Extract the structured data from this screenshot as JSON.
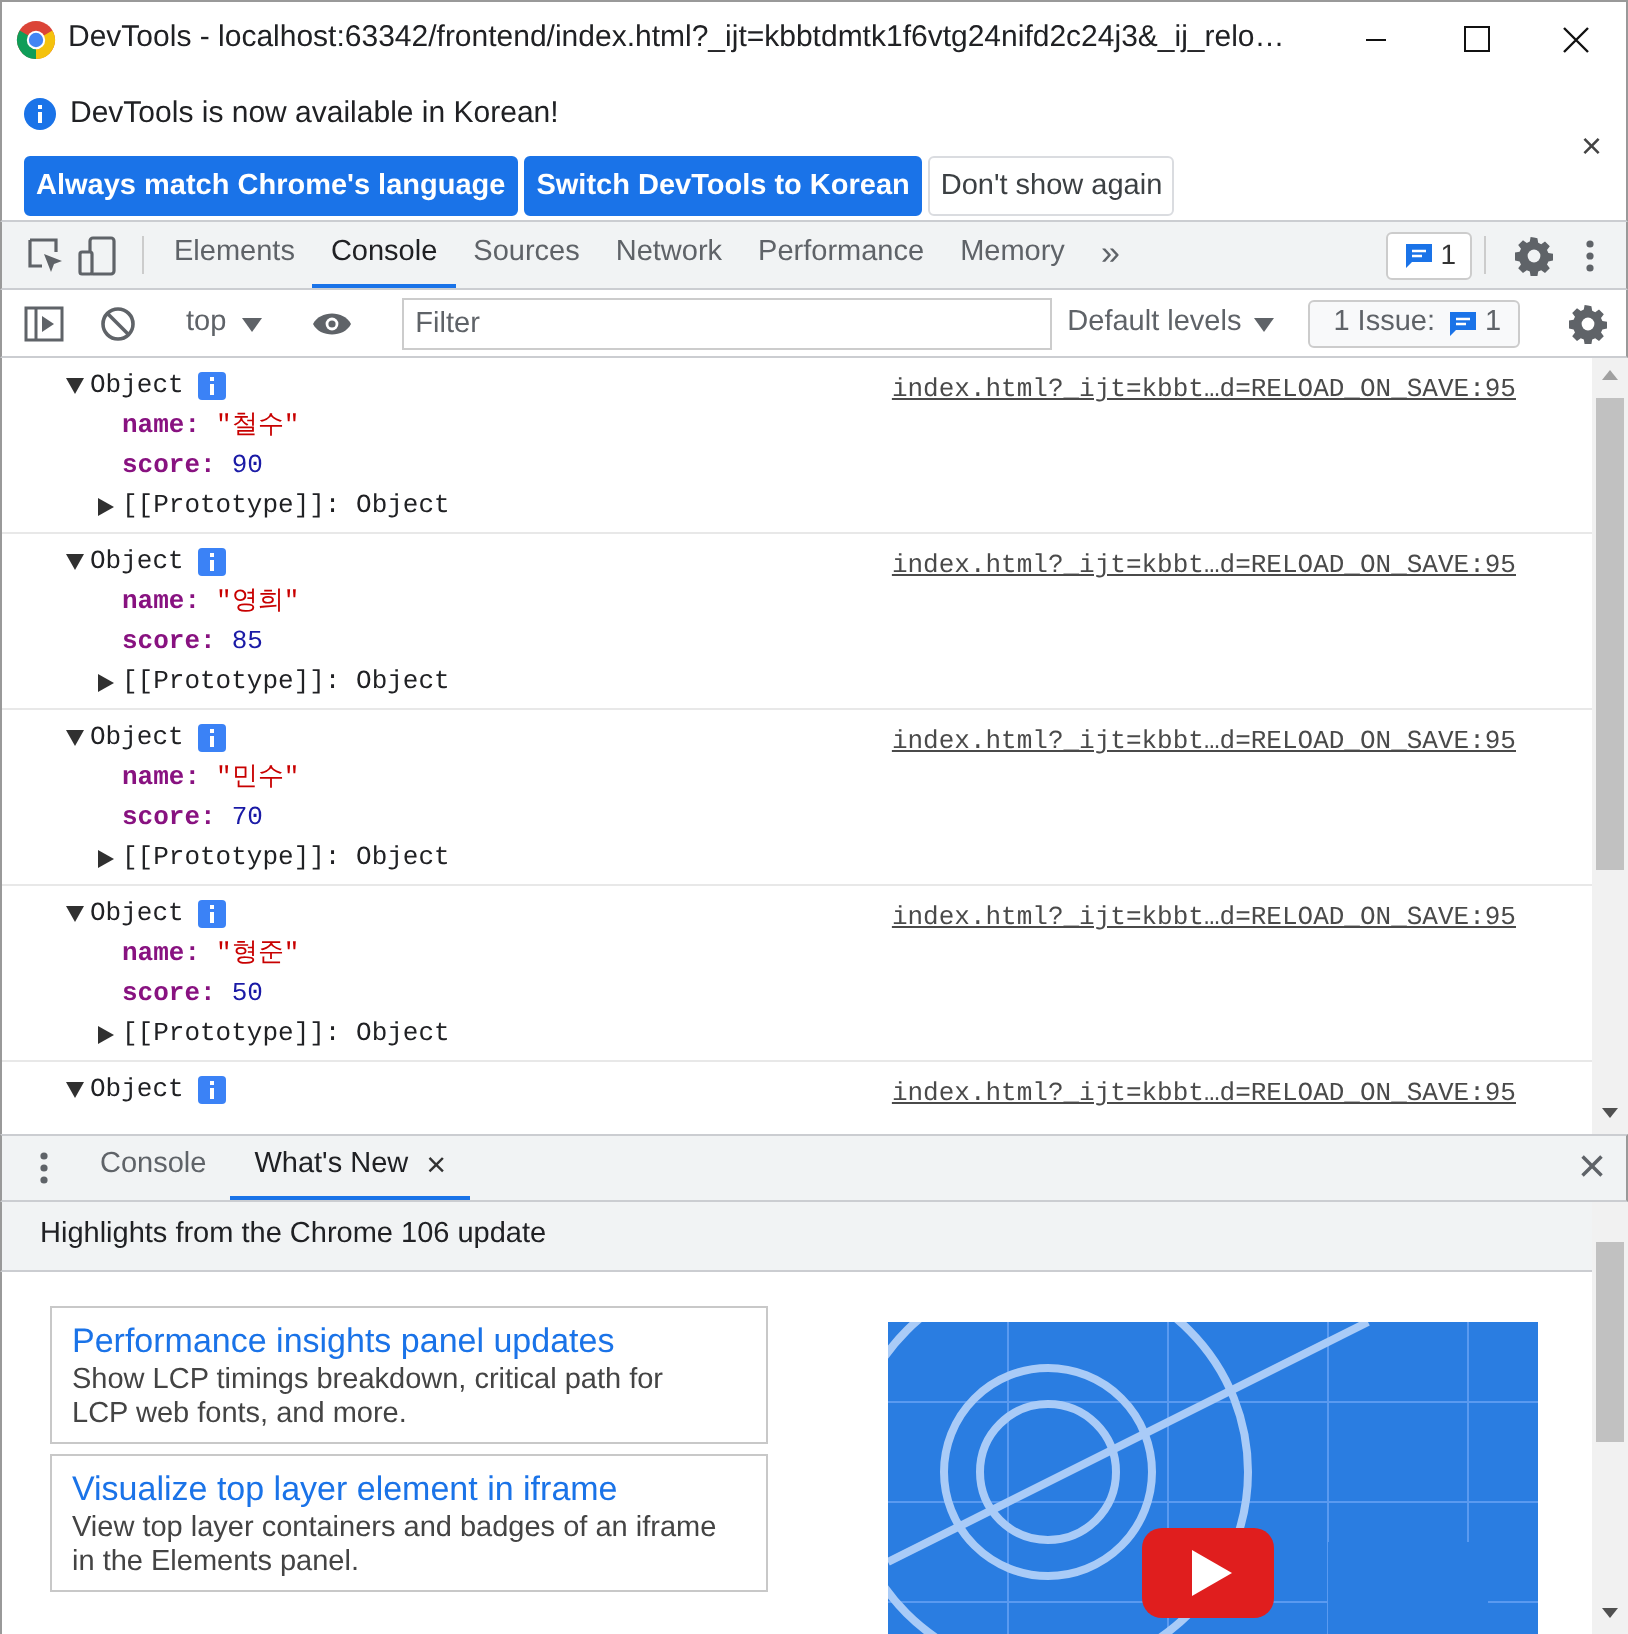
{
  "window": {
    "title": "DevTools - localhost:63342/frontend/index.html?_ijt=kbbtdmtk1f6vtg24nifd2c24j3&_ij_relo…"
  },
  "infobar": {
    "message": "DevTools is now available in Korean!",
    "close": "×",
    "buttons": [
      {
        "label": "Always match Chrome's language",
        "kind": "primary"
      },
      {
        "label": "Switch DevTools to Korean",
        "kind": "primary"
      },
      {
        "label": "Don't show again",
        "kind": "secondary"
      }
    ]
  },
  "tabs": [
    {
      "label": "Elements",
      "selected": false
    },
    {
      "label": "Console",
      "selected": true
    },
    {
      "label": "Sources",
      "selected": false
    },
    {
      "label": "Network",
      "selected": false
    },
    {
      "label": "Performance",
      "selected": false
    },
    {
      "label": "Memory",
      "selected": false
    }
  ],
  "more": "»",
  "messages_count": "1",
  "console_toolbar": {
    "context": "top",
    "filter_placeholder": "Filter",
    "levels": "Default levels",
    "issues_label": "1 Issue:",
    "issues_count": "1"
  },
  "entries": [
    {
      "label": "Object",
      "source": "index.html?_ijt=kbbt…d=RELOAD_ON_SAVE:95",
      "expanded": true,
      "properties": [
        {
          "key": "name:",
          "value": "\"철수\"",
          "kind": "string"
        },
        {
          "key": "score:",
          "value": "90",
          "kind": "number"
        }
      ],
      "prototype": {
        "label": "[[Prototype]]: Object",
        "expanded": false
      }
    },
    {
      "label": "Object",
      "source": "index.html?_ijt=kbbt…d=RELOAD_ON_SAVE:95",
      "expanded": true,
      "properties": [
        {
          "key": "name:",
          "value": "\"영희\"",
          "kind": "string"
        },
        {
          "key": "score:",
          "value": "85",
          "kind": "number"
        }
      ],
      "prototype": {
        "label": "[[Prototype]]: Object",
        "expanded": false
      }
    },
    {
      "label": "Object",
      "source": "index.html?_ijt=kbbt…d=RELOAD_ON_SAVE:95",
      "expanded": true,
      "properties": [
        {
          "key": "name:",
          "value": "\"민수\"",
          "kind": "string"
        },
        {
          "key": "score:",
          "value": "70",
          "kind": "number"
        }
      ],
      "prototype": {
        "label": "[[Prototype]]: Object",
        "expanded": false
      }
    },
    {
      "label": "Object",
      "source": "index.html?_ijt=kbbt…d=RELOAD_ON_SAVE:95",
      "expanded": true,
      "properties": [
        {
          "key": "name:",
          "value": "\"형준\"",
          "kind": "string"
        },
        {
          "key": "score:",
          "value": "50",
          "kind": "number"
        }
      ],
      "prototype": {
        "label": "[[Prototype]]: Object",
        "expanded": false
      }
    },
    {
      "label": "Object",
      "source": "index.html?_ijt=kbbt…d=RELOAD_ON_SAVE:95",
      "expanded": true
    }
  ],
  "drawer": {
    "tabs": [
      {
        "label": "Console",
        "selected": false
      },
      {
        "label": "What's New",
        "selected": true,
        "close": "×"
      }
    ],
    "close": "×",
    "header": "Highlights from the Chrome 106 update",
    "items": [
      {
        "title": "Performance insights panel updates",
        "description": "Show LCP timings breakdown, critical path for LCP web fonts, and more."
      },
      {
        "title": "Visualize top layer element in iframe",
        "description": "View top layer containers and badges of an iframe in the Elements panel."
      }
    ]
  }
}
